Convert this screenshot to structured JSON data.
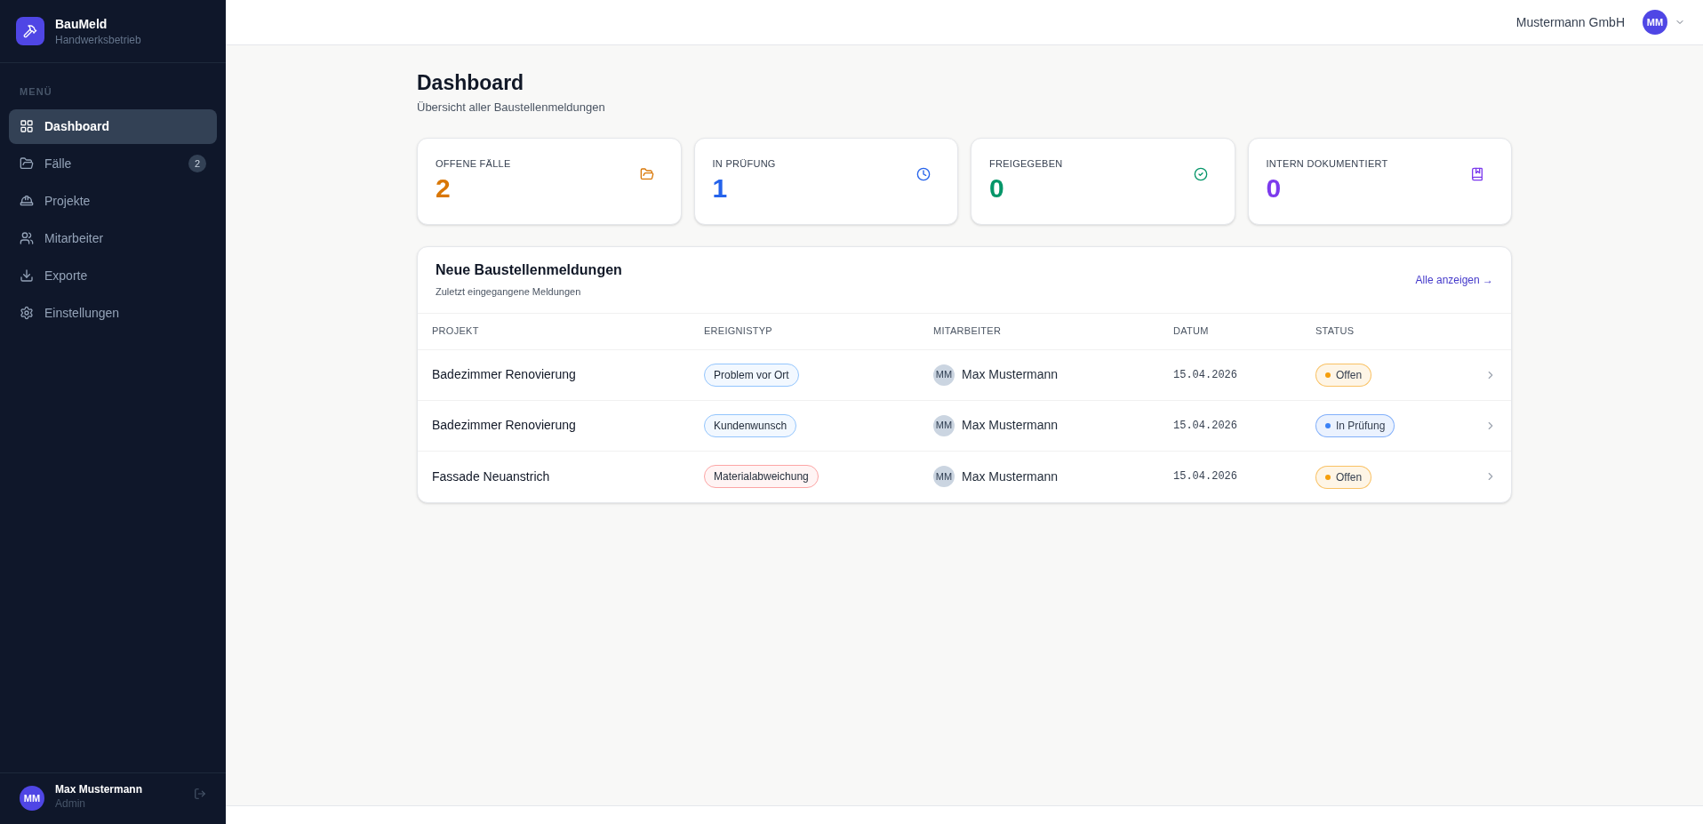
{
  "brand": {
    "name": "BauMeld",
    "subtitle": "Handwerksbetrieb"
  },
  "sidebar": {
    "section_label": "MENÜ",
    "items": [
      {
        "label": "Dashboard",
        "selected": true
      },
      {
        "label": "Fälle",
        "selected": false,
        "badge": "2"
      },
      {
        "label": "Projekte",
        "selected": false
      },
      {
        "label": "Mitarbeiter",
        "selected": false
      },
      {
        "label": "Exporte",
        "selected": false
      },
      {
        "label": "Einstellungen",
        "selected": false
      }
    ],
    "user": {
      "initials": "MM",
      "name": "Max Mustermann",
      "role": "Admin"
    }
  },
  "header": {
    "company": "Mustermann GmbH",
    "avatar_initials": "MM"
  },
  "page": {
    "title": "Dashboard",
    "subtitle": "Übersicht aller Baustellenmeldungen"
  },
  "stats": [
    {
      "label": "OFFENE FÄLLE",
      "value": "2",
      "color": "#d97706"
    },
    {
      "label": "IN PRÜFUNG",
      "value": "1",
      "color": "#2563eb"
    },
    {
      "label": "FREIGEGEBEN",
      "value": "0",
      "color": "#059669"
    },
    {
      "label": "INTERN DOKUMENTIERT",
      "value": "0",
      "color": "#7c3aed"
    }
  ],
  "reports": {
    "title": "Neue Baustellenmeldungen",
    "subtitle": "Zuletzt eingegangene Meldungen",
    "link": "Alle anzeigen →",
    "columns": [
      "PROJEKT",
      "EREIGNISTYP",
      "MITARBEITER",
      "DATUM",
      "STATUS"
    ],
    "rows": [
      {
        "project": "Badezimmer Renovierung",
        "event_type": {
          "label": "Problem vor Ort",
          "color": "#93c5fd"
        },
        "employee_initials": "MM",
        "employee": "Max Mustermann",
        "date": "15.04.2026",
        "status": {
          "label": "Offen",
          "color": "#f59e0b"
        }
      },
      {
        "project": "Badezimmer Renovierung",
        "event_type": {
          "label": "Kundenwunsch",
          "color": "#93c5fd"
        },
        "employee_initials": "MM",
        "employee": "Max Mustermann",
        "date": "15.04.2026",
        "status": {
          "label": "In Prüfung",
          "color": "#3b82f6"
        }
      },
      {
        "project": "Fassade Neuanstrich",
        "event_type": {
          "label": "Materialabweichung",
          "color": "#fca5a5"
        },
        "employee_initials": "MM",
        "employee": "Max Mustermann",
        "date": "15.04.2026",
        "status": {
          "label": "Offen",
          "color": "#f59e0b"
        }
      }
    ]
  }
}
